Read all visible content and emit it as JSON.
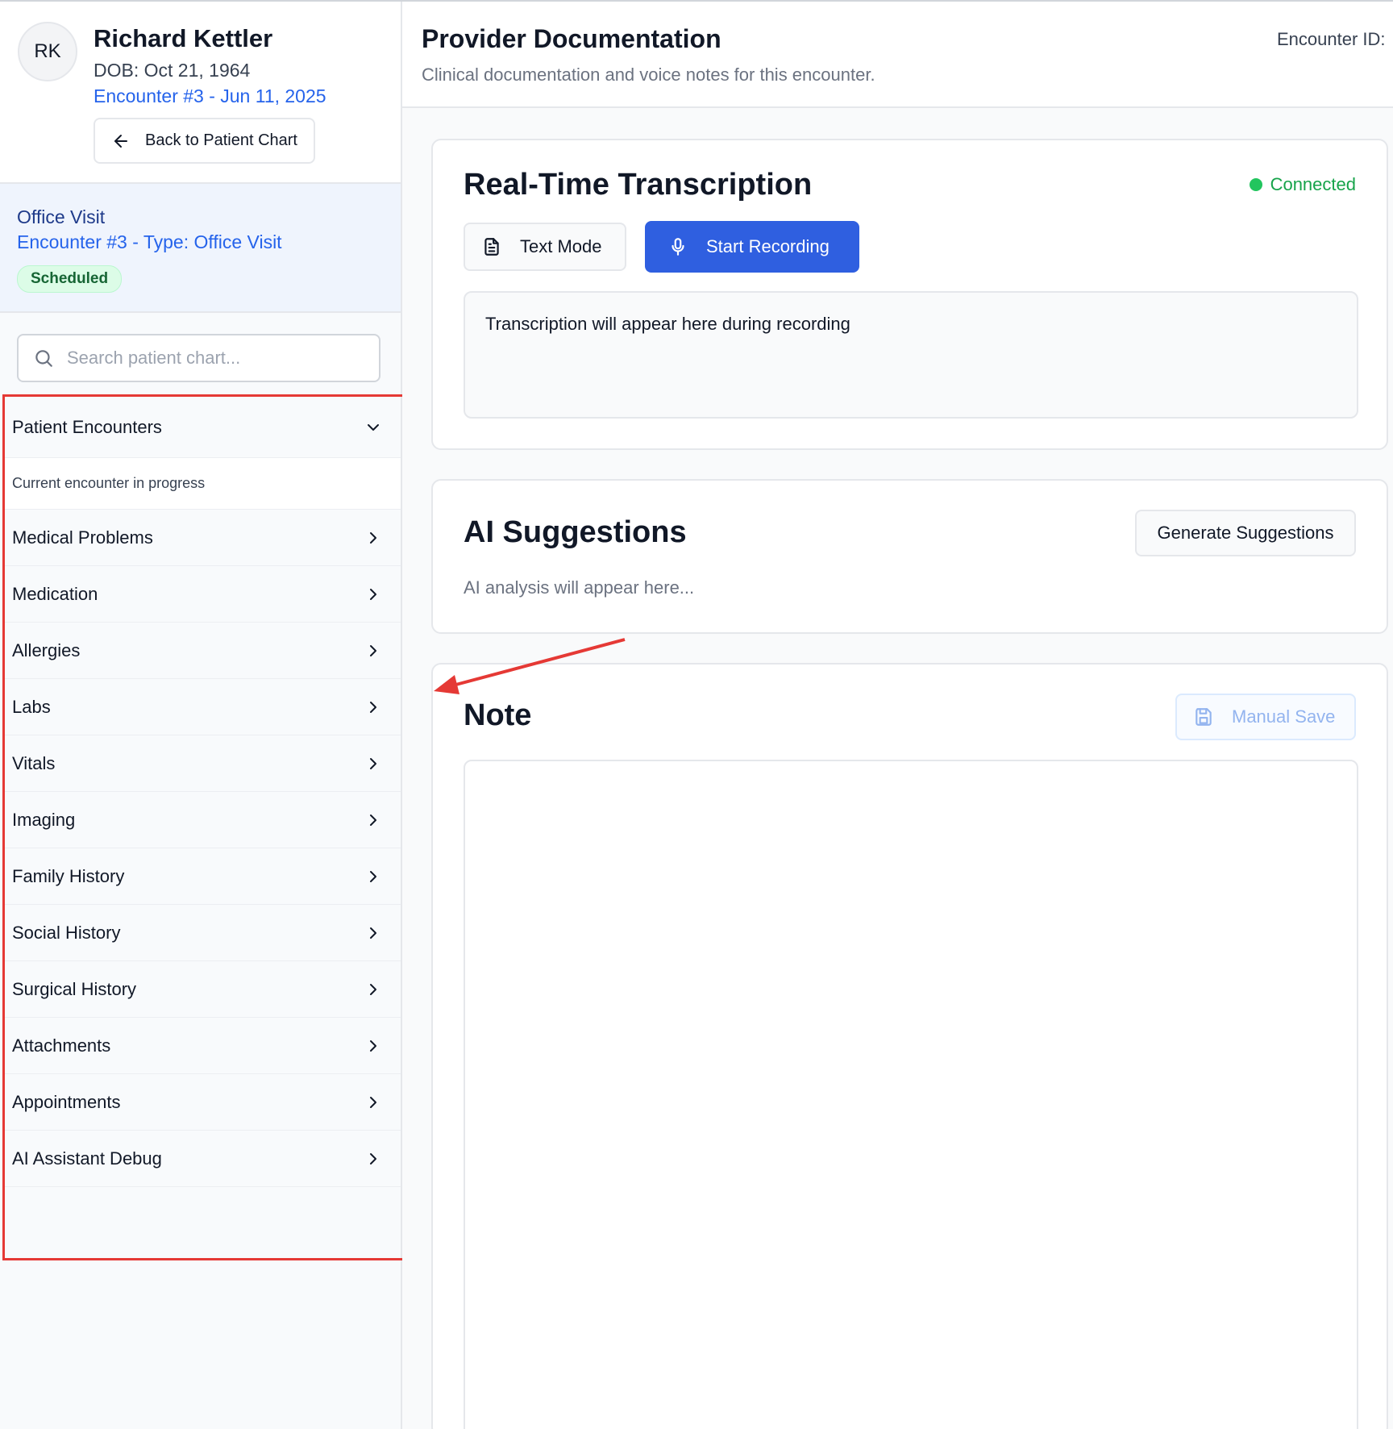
{
  "patient": {
    "initials": "RK",
    "name": "Richard Kettler",
    "dob": "DOB: Oct 21, 1964",
    "encounter": "Encounter #3 - Jun 11, 2025",
    "back_label": "Back to Patient Chart"
  },
  "visit": {
    "title": "Office Visit",
    "subtitle": "Encounter #3 - Type: Office Visit",
    "status_badge": "Scheduled"
  },
  "search": {
    "placeholder": "Search patient chart..."
  },
  "nav": {
    "header": "Patient Encounters",
    "header_sub": "Current encounter in progress",
    "items": [
      "Medical Problems",
      "Medication",
      "Allergies",
      "Labs",
      "Vitals",
      "Imaging",
      "Family History",
      "Social History",
      "Surgical History",
      "Attachments",
      "Appointments",
      "AI Assistant Debug"
    ]
  },
  "header": {
    "title": "Provider Documentation",
    "subtitle": "Clinical documentation and voice notes for this encounter.",
    "encounter_id_label": "Encounter ID:"
  },
  "transcription": {
    "title": "Real-Time Transcription",
    "status": "Connected",
    "text_mode_label": "Text Mode",
    "record_label": "Start Recording",
    "placeholder": "Transcription will appear here during recording"
  },
  "ai": {
    "title": "AI Suggestions",
    "button": "Generate Suggestions",
    "placeholder": "AI analysis will appear here..."
  },
  "note": {
    "title": "Note",
    "save_label": "Manual Save",
    "value": ""
  },
  "colors": {
    "primary": "#2f5fe0",
    "connected": "#22c55e",
    "annotation": "#e53935"
  }
}
